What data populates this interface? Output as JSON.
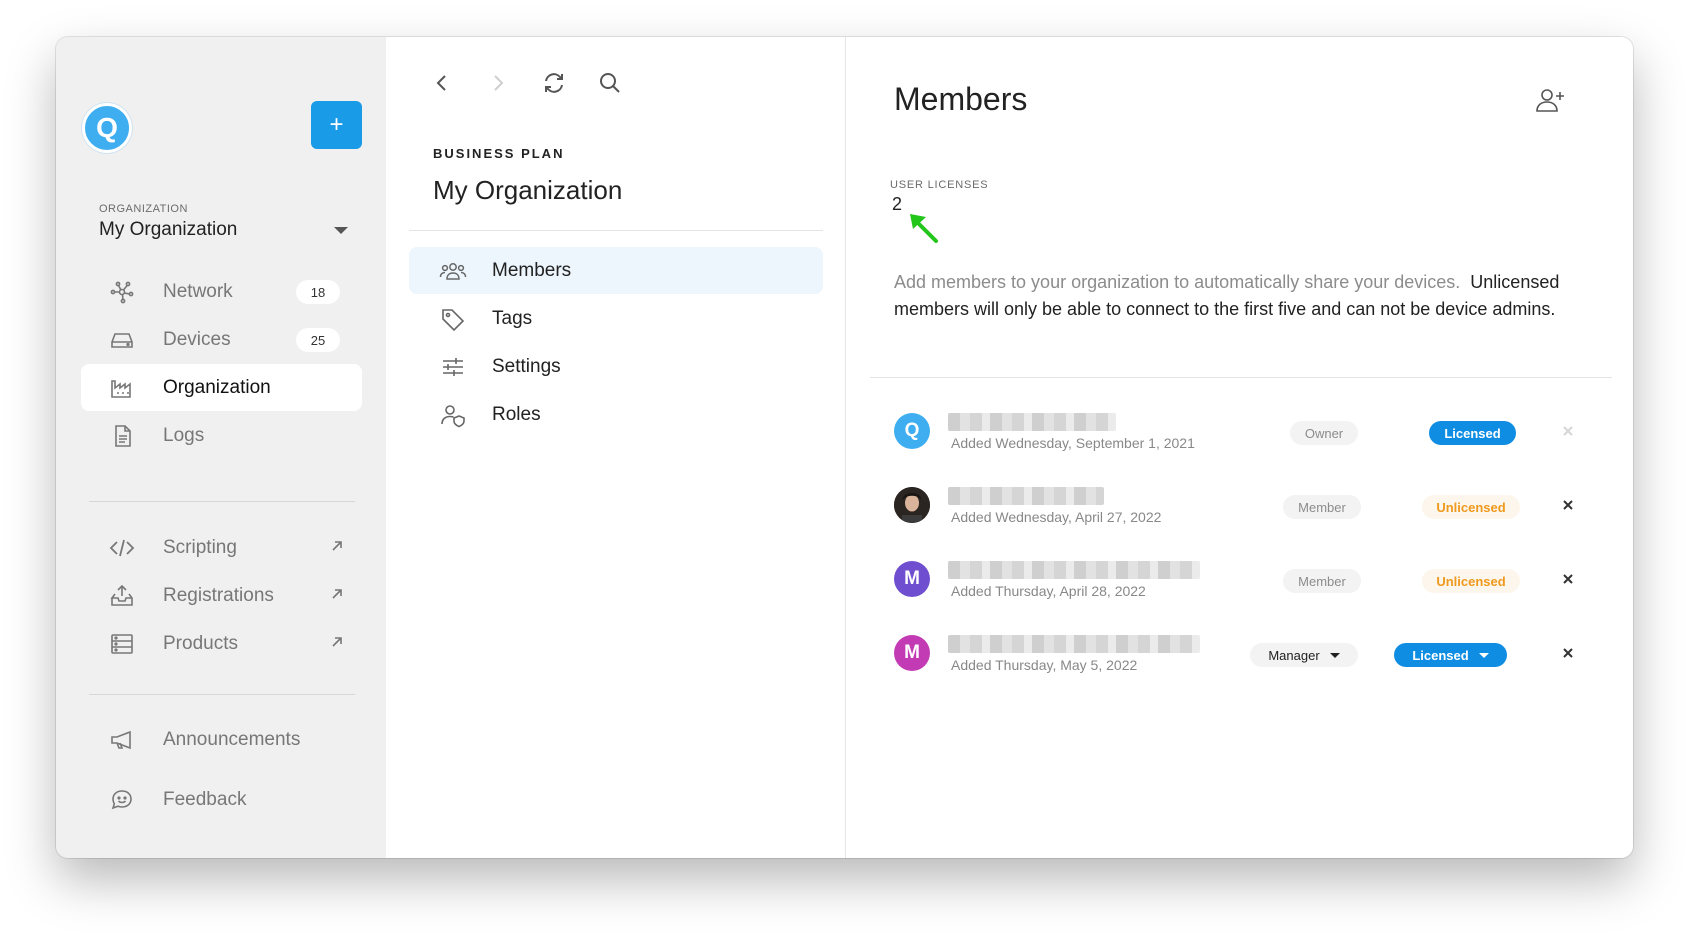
{
  "sidebar": {
    "avatar_letter": "Q",
    "add_label": "+",
    "org_label": "ORGANIZATION",
    "org_name": "My Organization",
    "items": [
      {
        "label": "Network",
        "badge": "18"
      },
      {
        "label": "Devices",
        "badge": "25"
      },
      {
        "label": "Organization"
      },
      {
        "label": "Logs"
      },
      {
        "label": "Scripting"
      },
      {
        "label": "Registrations"
      },
      {
        "label": "Products"
      },
      {
        "label": "Announcements"
      },
      {
        "label": "Feedback"
      }
    ]
  },
  "middle": {
    "plan": "BUSINESS PLAN",
    "title": "My Organization",
    "menu": [
      {
        "label": "Members"
      },
      {
        "label": "Tags"
      },
      {
        "label": "Settings"
      },
      {
        "label": "Roles"
      }
    ]
  },
  "members": {
    "title": "Members",
    "licenses_label": "USER LICENSES",
    "licenses_value": "2",
    "description": "Add members to your organization to automatically share your devices.",
    "description_emphasis": "Unlicensed members will only be able to connect to the first five and can not be device admins.",
    "rows": [
      {
        "avatar": "Q",
        "avatar_color": "#3faef0",
        "added": "Added Wednesday, September 1, 2021",
        "role": "Owner",
        "license": "Licensed"
      },
      {
        "avatar": "",
        "avatar_color": "#3a2f2a",
        "added": "Added Wednesday, April 27, 2022",
        "role": "Member",
        "license": "Unlicensed"
      },
      {
        "avatar": "M",
        "avatar_color": "#6f4fd0",
        "added": "Added Thursday, April 28, 2022",
        "role": "Member",
        "license": "Unlicensed"
      },
      {
        "avatar": "M",
        "avatar_color": "#c23bb4",
        "added": "Added Thursday, May 5, 2022",
        "role": "Manager",
        "license": "Licensed"
      }
    ]
  },
  "colors": {
    "accent": "#1a9be8",
    "licensed": "#0f8de3",
    "unlicensed": "#ef9a1e",
    "arrow": "#22c51a"
  }
}
